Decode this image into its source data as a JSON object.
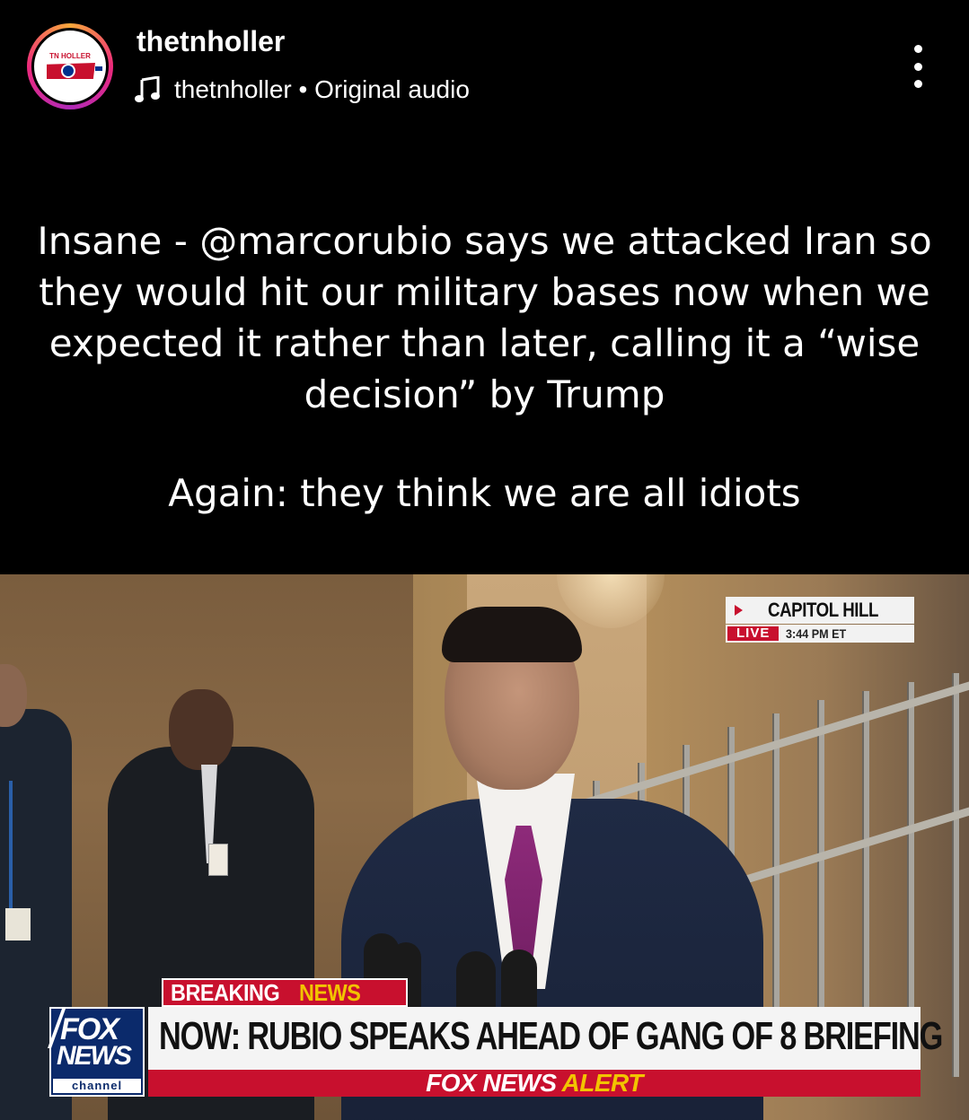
{
  "header": {
    "username": "thetnholler",
    "avatar_label": "TN HOLLER",
    "audio_text": "thetnholler • Original audio"
  },
  "caption": {
    "line1": "Insane - @marcorubio says we attacked Iran so they would hit our military bases now when we expected it rather than later, calling it a “wise decision” by Trump",
    "line2": "Again: they think we are all idiots"
  },
  "video": {
    "location": "CAPITOL HILL",
    "live_tag": "LIVE",
    "time": "3:44 PM ET",
    "breaking_a": "BREAKING",
    "breaking_b": "NEWS",
    "headline": "NOW: RUBIO SPEAKS AHEAD OF GANG OF 8 BRIEFING",
    "alert_a": "FOX NEWS",
    "alert_b": "ALERT",
    "logo_fox": "FOX",
    "logo_news": "NEWS",
    "logo_channel": "channel"
  },
  "colors": {
    "background": "#000000",
    "fox_red": "#c8102e",
    "fox_blue": "#0b2a6b",
    "alert_yellow": "#f2c400"
  }
}
